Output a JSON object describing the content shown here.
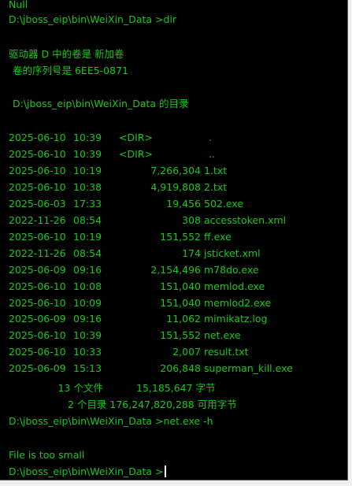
{
  "colors": {
    "background": "#000000",
    "text": "#19c819",
    "cursor": "#ffffff",
    "frame": "#f0f0f0"
  },
  "console": {
    "null_line": "Null",
    "prompt1": "D:\\jboss_eip\\bin\\WeiXin_Data >dir",
    "volume_label": "驱动器 D 中的卷是 新加卷",
    "volume_serial": "卷的序列号是 6EE5-0871",
    "dir_of": "D:\\jboss_eip\\bin\\WeiXin_Data 的目录",
    "entries": [
      {
        "date": "2025-06-10",
        "time": "10:39",
        "dir": "<DIR>",
        "size": "",
        "name": "."
      },
      {
        "date": "2025-06-10",
        "time": "10:39",
        "dir": "<DIR>",
        "size": "",
        "name": ".."
      },
      {
        "date": "2025-06-10",
        "time": "10:19",
        "dir": "",
        "size": "7,266,304",
        "name": "1.txt"
      },
      {
        "date": "2025-06-10",
        "time": "10:38",
        "dir": "",
        "size": "4,919,808",
        "name": "2.txt"
      },
      {
        "date": "2025-06-03",
        "time": "17:33",
        "dir": "",
        "size": "19,456",
        "name": "502.exe"
      },
      {
        "date": "2022-11-26",
        "time": "08:54",
        "dir": "",
        "size": "308",
        "name": "accesstoken.xml"
      },
      {
        "date": "2025-06-10",
        "time": "10:19",
        "dir": "",
        "size": "151,552",
        "name": "ff.exe"
      },
      {
        "date": "2022-11-26",
        "time": "08:54",
        "dir": "",
        "size": "174",
        "name": "jsticket.xml"
      },
      {
        "date": "2025-06-09",
        "time": "09:16",
        "dir": "",
        "size": "2,154,496",
        "name": "m78do.exe"
      },
      {
        "date": "2025-06-10",
        "time": "10:08",
        "dir": "",
        "size": "151,040",
        "name": "memlod.exe"
      },
      {
        "date": "2025-06-10",
        "time": "10:09",
        "dir": "",
        "size": "151,040",
        "name": "memlod2.exe"
      },
      {
        "date": "2025-06-09",
        "time": "09:16",
        "dir": "",
        "size": "11,062",
        "name": "mimikatz.log"
      },
      {
        "date": "2025-06-10",
        "time": "10:39",
        "dir": "",
        "size": "151,552",
        "name": "net.exe"
      },
      {
        "date": "2025-06-10",
        "time": "10:33",
        "dir": "",
        "size": "2,007",
        "name": "result.txt"
      },
      {
        "date": "2025-06-09",
        "time": "15:13",
        "dir": "",
        "size": "206,848",
        "name": "superman_kill.exe"
      }
    ],
    "summary_files": "13 个文件",
    "summary_files_bytes": "15,185,647 字节",
    "summary_dirs": "2 个目录 176,247,820,288 可用字节",
    "prompt2": "D:\\jboss_eip\\bin\\WeiXin_Data >net.exe -h",
    "error_line": "File is too small",
    "prompt3": "D:\\jboss_eip\\bin\\WeiXin_Data >"
  }
}
